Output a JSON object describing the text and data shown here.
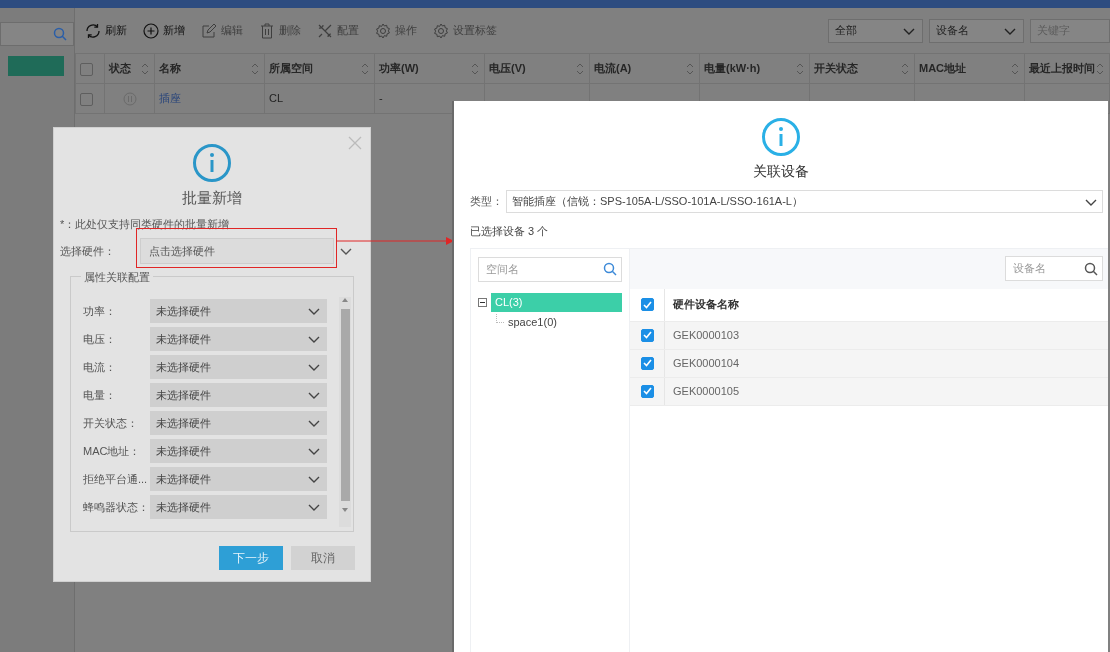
{
  "toolbar": [
    {
      "label": "刷新",
      "disabled": false
    },
    {
      "label": "新增",
      "disabled": false
    },
    {
      "label": "编辑",
      "disabled": true
    },
    {
      "label": "删除",
      "disabled": true
    },
    {
      "label": "配置",
      "disabled": true
    },
    {
      "label": "操作",
      "disabled": true
    },
    {
      "label": "设置标签",
      "disabled": true
    }
  ],
  "filters": [
    {
      "value": "全部"
    },
    {
      "value": "设备名"
    }
  ],
  "keyword": {
    "placeholder": "关键字"
  },
  "table": {
    "select_all": {
      "checked": false
    },
    "columns": [
      {
        "label": "状态"
      },
      {
        "label": "名称"
      },
      {
        "label": "所属空间"
      },
      {
        "label": "功率(W)"
      },
      {
        "label": "电压(V)"
      },
      {
        "label": "电流(A)"
      },
      {
        "label": "电量(kW·h)"
      },
      {
        "label": "开关状态"
      },
      {
        "label": "MAC地址"
      },
      {
        "label": "最近上报时间"
      }
    ],
    "rows": [
      {
        "checked": false,
        "name": "插座",
        "space": "CL",
        "power": "-"
      }
    ]
  },
  "batch_dialog": {
    "title": "批量新增",
    "note": "*：此处仅支持同类硬件的批量新增",
    "hardware_label": "选择硬件：",
    "hardware_placeholder": "点击选择硬件",
    "group_title": "属性关联配置",
    "fields": [
      {
        "label": "功率：",
        "value": "未选择硬件"
      },
      {
        "label": "电压：",
        "value": "未选择硬件"
      },
      {
        "label": "电流：",
        "value": "未选择硬件"
      },
      {
        "label": "电量：",
        "value": "未选择硬件"
      },
      {
        "label": "开关状态：",
        "value": "未选择硬件"
      },
      {
        "label": "MAC地址：",
        "value": "未选择硬件"
      },
      {
        "label": "拒绝平台通...",
        "value": "未选择硬件"
      },
      {
        "label": "蜂鸣器状态：",
        "value": "未选择硬件"
      }
    ],
    "buttons": [
      {
        "label": "下一步",
        "kind": "primary"
      },
      {
        "label": "取消",
        "kind": "secondary"
      }
    ]
  },
  "link_dialog": {
    "title": "关联设备",
    "type_label": "类型：",
    "type_value": "智能插座（信锐：SPS-105A-L/SSO-101A-L/SSO-161A-L）",
    "selected_count": "已选择设备 3 个",
    "space_search": {
      "placeholder": "空间名"
    },
    "tree": [
      {
        "label": "CL(3)",
        "selected": true,
        "expanded": true,
        "children": [
          {
            "label": "space1(0)",
            "selected": false
          }
        ]
      }
    ],
    "device_search": {
      "placeholder": "设备名"
    },
    "header": {
      "label": "硬件设备名称",
      "checked": true
    },
    "devices": [
      {
        "name": "GEK0000103",
        "checked": true
      },
      {
        "name": "GEK0000104",
        "checked": true
      },
      {
        "name": "GEK0000105",
        "checked": true
      }
    ]
  }
}
